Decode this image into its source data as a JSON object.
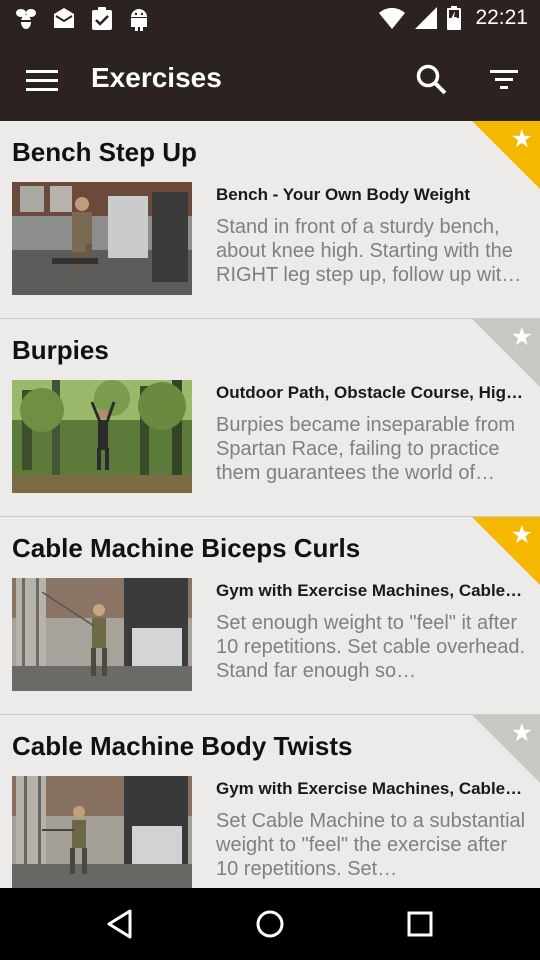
{
  "status_bar": {
    "time": "22:21",
    "icons": [
      "bee-icon",
      "mail-icon",
      "clipboard-check-icon",
      "android-icon",
      "wifi-icon",
      "signal-icon",
      "battery-icon"
    ]
  },
  "app_bar": {
    "title": "Exercises",
    "icons": [
      "menu-icon",
      "search-icon",
      "filter-icon"
    ]
  },
  "exercises": [
    {
      "name": "Bench Step Up",
      "location": "Bench - Your Own Body Weight",
      "description": "Stand in front of a sturdy bench, about knee high. Starting with the RIGHT leg step up, follow up wit…",
      "favorite": true
    },
    {
      "name": "Burpies",
      "location": "Outdoor Path, Obstacle Course, High…",
      "description": "Burpies became inseparable from Spartan Race, failing to practice them guarantees the world of…",
      "favorite": false
    },
    {
      "name": "Cable Machine Biceps Curls",
      "location": "Gym with Exercise Machines, Cable…",
      "description": "Set enough weight to \"feel\" it after 10 repetitions. Set cable overhead. Stand far enough so…",
      "favorite": true
    },
    {
      "name": "Cable Machine Body Twists",
      "location": "Gym with Exercise Machines, Cable…",
      "description": "Set Cable Machine to a substantial weight to \"feel\" the exercise after 10 repetitions. Set…",
      "favorite": false
    }
  ],
  "favorite_star": "★",
  "colors": {
    "bar_background": "#2c2320",
    "favorite_on": "#f5b800",
    "favorite_off": "#c9c7c4",
    "list_background": "#ecebe9"
  },
  "nav_bar": {
    "icons": [
      "back-icon",
      "home-icon",
      "recents-icon"
    ]
  }
}
